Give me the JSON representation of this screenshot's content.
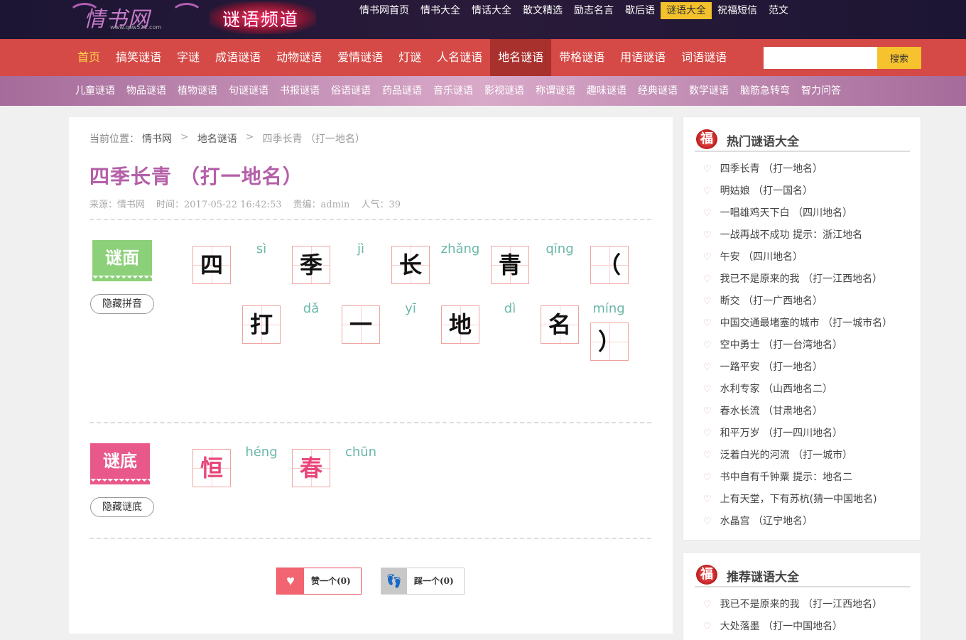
{
  "logo": {
    "text": "情书网",
    "sub": "www.qsw521.com"
  },
  "channel_title": "谜语频道",
  "top_nav": [
    "情书网首页",
    "情书大全",
    "情话大全",
    "散文精选",
    "励志名言",
    "歇后语",
    "谜语大全",
    "祝福短信",
    "范文"
  ],
  "main_nav": [
    "首页",
    "搞笑谜语",
    "字谜",
    "成语谜语",
    "动物谜语",
    "爱情谜语",
    "灯谜",
    "人名谜语",
    "地名谜语",
    "带格谜语",
    "用语谜语",
    "词语谜语"
  ],
  "search": {
    "placeholder": "",
    "button": "搜索"
  },
  "sub_nav": [
    "儿童谜语",
    "物品谜语",
    "植物谜语",
    "句谜谜语",
    "书报谜语",
    "俗语谜语",
    "药品谜语",
    "音乐谜语",
    "影视谜语",
    "称谓谜语",
    "趣味谜语",
    "经典谜语",
    "数学谜语",
    "脑筋急转弯",
    "智力问答"
  ],
  "breadcrumb": {
    "label": "当前位置：",
    "home": "情书网",
    "category": "地名谜语",
    "current": "四季长青 （打一地名）"
  },
  "title": "四季长青 （打一地名）",
  "meta": {
    "source": "来源：情书网",
    "time": "时间：2017-05-22 16:42:53",
    "editor": "责编：admin",
    "views": "人气：39"
  },
  "riddle": {
    "label": "谜面",
    "toggle": "隐藏拼音",
    "chars": [
      {
        "c": "四",
        "py": "sì"
      },
      {
        "c": "季",
        "py": "jì"
      },
      {
        "c": "长",
        "py": "zhǎng"
      },
      {
        "c": "青",
        "py": "qīng"
      },
      {
        "c": "（",
        "py": ""
      },
      {
        "c": "打",
        "py": "dǎ"
      },
      {
        "c": "一",
        "py": "yī"
      },
      {
        "c": "地",
        "py": "dì"
      },
      {
        "c": "名",
        "py": "míng"
      },
      {
        "c": "）",
        "py": ""
      }
    ]
  },
  "answer": {
    "label": "谜底",
    "toggle": "隐藏谜底",
    "chars": [
      {
        "c": "恒",
        "py": "héng"
      },
      {
        "c": "春",
        "py": "chūn"
      }
    ]
  },
  "vote": {
    "like": "赞一个(0)",
    "dislike": "踩一个(0)"
  },
  "hot": {
    "title": "热门谜语大全",
    "items": [
      "四季长青 （打一地名）",
      "明姑娘 （打一国名）",
      "一唱雄鸡天下白 （四川地名）",
      "一战再战不成功 提示：浙江地名",
      "午安 （四川地名）",
      "我已不是原来的我 （打一江西地名）",
      "断交 （打一广西地名）",
      "中国交通最堵塞的城市 （打一城市名）",
      "空中勇士 （打一台湾地名）",
      "一路平安 （打一地名）",
      "水利专家 （山西地名二）",
      "春水长流 （甘肃地名）",
      "和平万岁 （打一四川地名）",
      "泛着白光的河流 （打一城市）",
      "书中自有千钟粟 提示：地名二",
      "上有天堂，下有苏杭(猜一中国地名)",
      "水晶宫 （辽宁地名）"
    ]
  },
  "recommend": {
    "title": "推荐谜语大全",
    "items": [
      "我已不是原来的我 （打一江西地名）",
      "大处落墨 （打一中国地名）"
    ]
  }
}
